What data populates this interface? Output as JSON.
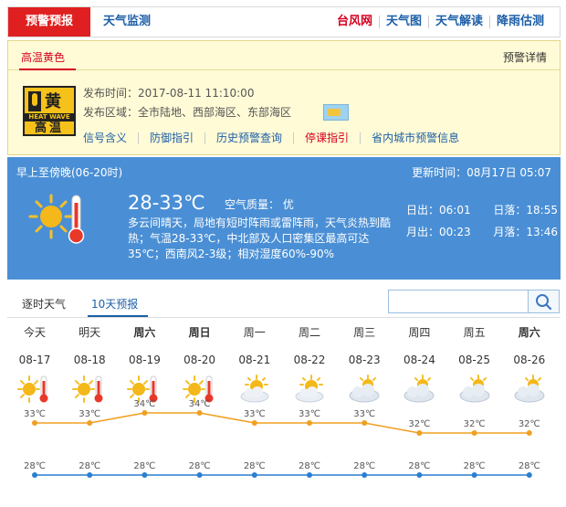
{
  "nav": {
    "alert_tab": "预警预报",
    "monitor_tab": "天气监测",
    "links": [
      "台风网",
      "天气图",
      "天气解读",
      "降雨估测"
    ]
  },
  "warning": {
    "level_tab": "高温黄色",
    "detail_link": "预警详情",
    "badge": {
      "level": "黄",
      "en": "HEAT WAVE",
      "cn": "高温"
    },
    "issue_time": "发布时间：2017-08-11 11:10:00",
    "issue_area": "发布区域：全市陆地、西部海区、东部海区",
    "links": [
      "信号含义",
      "防御指引",
      "历史预警查询",
      "停课指引",
      "省内城市预警信息"
    ],
    "colors": {
      "badge": "#f6c21a",
      "accent": "#d4001e"
    }
  },
  "now": {
    "period": "早上至傍晚(06-20时)",
    "update": "更新时间：08月17日 05:07",
    "temp": "28-33℃",
    "air_quality": "空气质量： 优",
    "desc": "多云间晴天，局地有短时阵雨或雷阵雨，天气炎热到酷热；气温28-33℃，中北部及人口密集区最高可达35℃；西南风2-3级；相对湿度60%-90%",
    "sunrise": "日出：06:01",
    "sunset": "日落：18:55",
    "moonrise": "月出：00:23",
    "moonset": "月落：13:46",
    "icon": "sun-thermometer-icon",
    "color": "#4a8fd5"
  },
  "forecast_tabs": {
    "tab1": "逐时天气",
    "tab2": "10天预报"
  },
  "search": {
    "placeholder": ""
  },
  "chart_data": {
    "type": "line",
    "categories": [
      "08-17",
      "08-18",
      "08-19",
      "08-20",
      "08-21",
      "08-22",
      "08-23",
      "08-24",
      "08-25",
      "08-26"
    ],
    "weekdays": [
      "今天",
      "明天",
      "周六",
      "周日",
      "周一",
      "周二",
      "周三",
      "周四",
      "周五",
      "周六"
    ],
    "weekday_bold": [
      false,
      false,
      true,
      true,
      false,
      false,
      false,
      false,
      false,
      true
    ],
    "icons": [
      "hot-sun",
      "hot-sun",
      "hot-sun",
      "hot-sun",
      "sun-cloud",
      "sun-cloud",
      "cloud-sun",
      "cloud-sun",
      "cloud-sun",
      "cloud-sun"
    ],
    "series": [
      {
        "values": [
          33,
          33,
          34,
          34,
          33,
          33,
          33,
          32,
          32,
          32
        ],
        "color": "#f0a020"
      },
      {
        "values": [
          28,
          28,
          28,
          28,
          28,
          28,
          28,
          28,
          28,
          28
        ],
        "color": "#2a7fd0"
      }
    ],
    "unit": "℃",
    "xlabel": "",
    "ylabel": ""
  }
}
